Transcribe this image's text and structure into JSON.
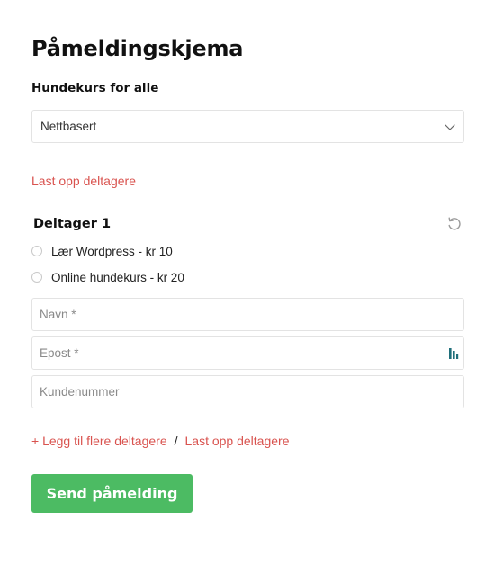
{
  "form": {
    "title": "Påmeldingskjema",
    "course_label": "Hundekurs for alle",
    "course_select": {
      "value": "Nettbasert",
      "icon": "chevron-down-icon"
    },
    "upload_link_top": "Last opp deltagere",
    "participant": {
      "heading": "Deltager 1",
      "reset_icon": "reset-icon",
      "options": [
        {
          "label": "Lær Wordpress - kr 10",
          "selected": false
        },
        {
          "label": "Online hundekurs - kr 20",
          "selected": false
        }
      ],
      "fields": {
        "name_placeholder": "Navn *",
        "email_placeholder": "Epost *",
        "customer_number_placeholder": "Kundenummer"
      }
    },
    "add_more_link": "+ Legg til flere deltagere",
    "separator": "/",
    "upload_link_bottom": "Last opp deltagere",
    "submit_label": "Send påmelding"
  },
  "colors": {
    "link": "#d9534f",
    "submit_bg": "#4cbb63",
    "field_border": "#e3e3e3",
    "email_icon": "#1f6f7a"
  }
}
